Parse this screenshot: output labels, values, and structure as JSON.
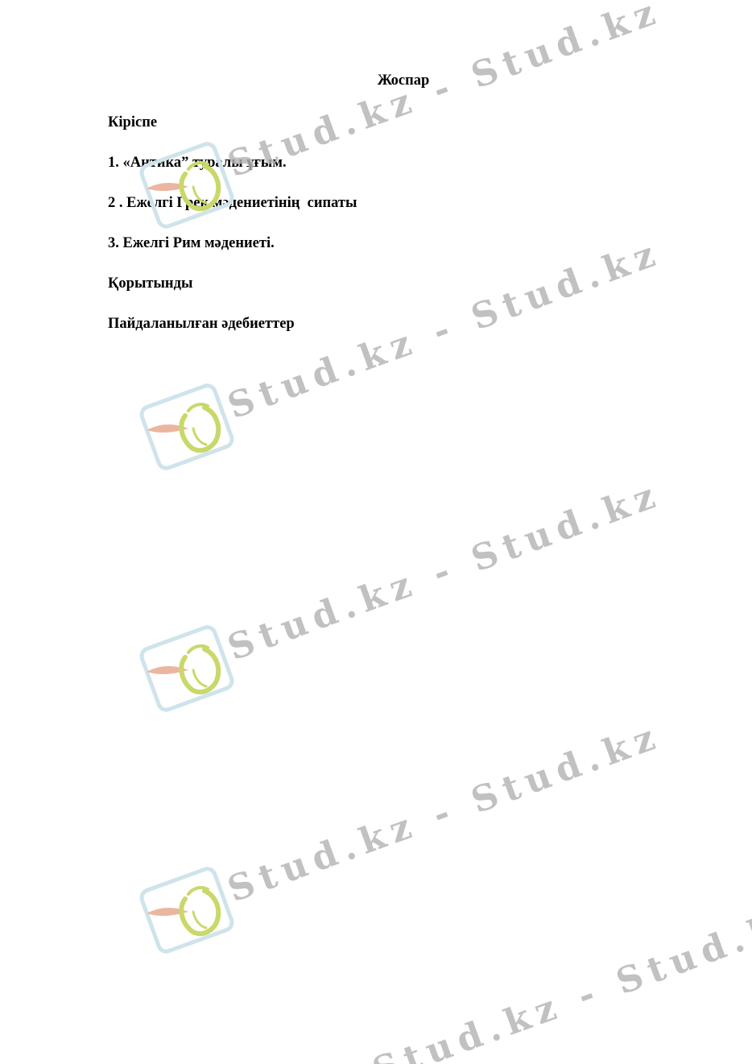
{
  "document": {
    "title": "Жоспар",
    "items": [
      "Кіріспе",
      "1. «Антика” туралы ұғым.",
      "2 . Ежелгі Грек мәдениетінің  сипаты",
      "3. Ежелгі Рим мәдениеті.",
      "Қорытынды",
      "Пайдаланылған әдебиеттер"
    ]
  },
  "watermark": {
    "text": "Stud.kz - Stud.kz",
    "text_color": "#b3b3b3",
    "logo_frame_color": "#cfe4ea",
    "logo_bird_color": "#c9d86a",
    "logo_wing_color": "#e8a98f"
  }
}
